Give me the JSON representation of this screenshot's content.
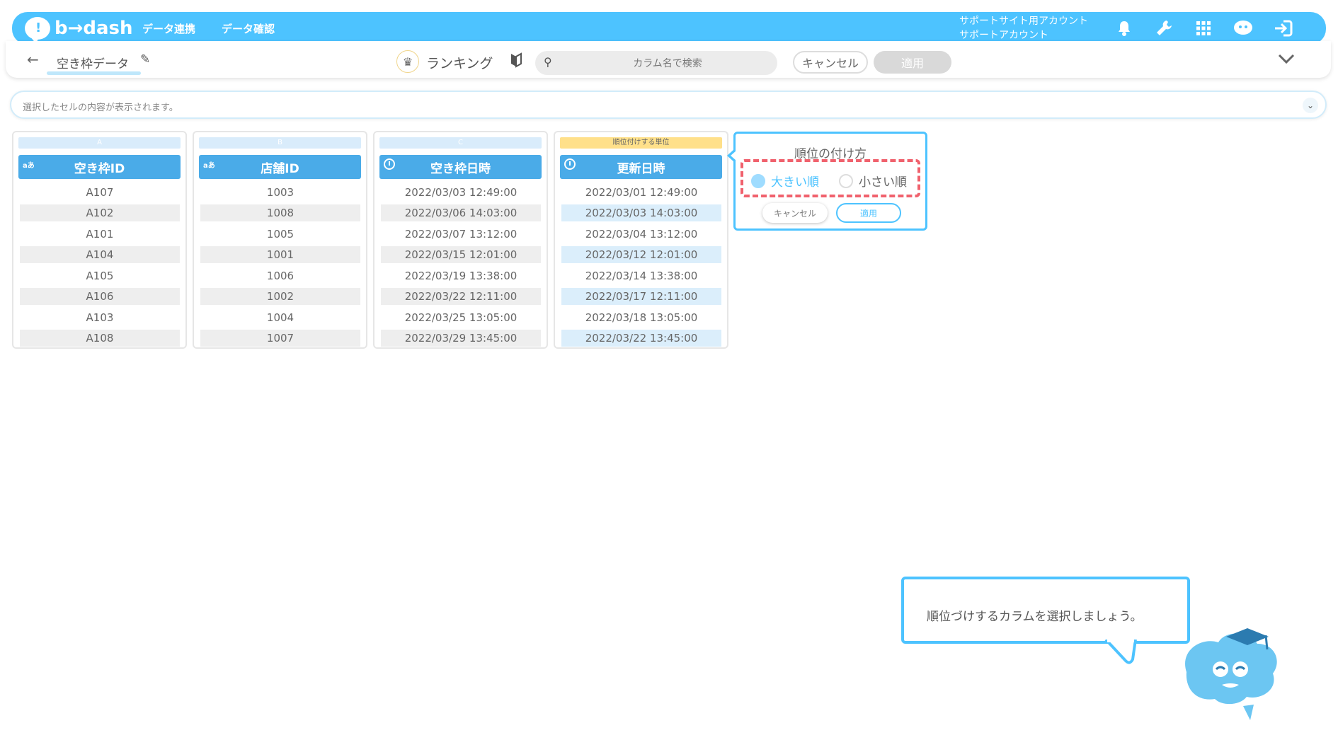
{
  "header": {
    "logo_text": "b→dash",
    "nav": [
      "データ連携",
      "データ確認"
    ],
    "account_line1": "サポートサイト用アカウント",
    "account_line2": "サポートアカウント",
    "icons": [
      "bell-icon",
      "wrench-icon",
      "grid-icon",
      "mascot-chat-icon",
      "logout-icon"
    ],
    "color": "#4dc3ff"
  },
  "toolbar": {
    "back_icon": "←",
    "table_name": "空き枠データ",
    "rank_label": "ランキング",
    "search_placeholder": "カラム名で検索",
    "cancel_label": "キャンセル",
    "apply_label": "適用"
  },
  "formula_bar": {
    "placeholder": "選択したセルの内容が表示されます。"
  },
  "columns": [
    {
      "letter": "A",
      "type_icon": "text-type-icon",
      "name": "空き枠ID",
      "cells": [
        "A107",
        "A102",
        "A101",
        "A104",
        "A105",
        "A106",
        "A103",
        "A108"
      ]
    },
    {
      "letter": "B",
      "type_icon": "text-type-icon",
      "name": "店舗ID",
      "cells": [
        "1003",
        "1008",
        "1005",
        "1001",
        "1006",
        "1002",
        "1004",
        "1007"
      ]
    },
    {
      "letter": "C",
      "type_icon": "datetime-type-icon",
      "name": "空き枠日時",
      "cells": [
        "2022/03/03 12:49:00",
        "2022/03/06 14:03:00",
        "2022/03/07 13:12:00",
        "2022/03/15 12:01:00",
        "2022/03/19 13:38:00",
        "2022/03/22 12:11:00",
        "2022/03/25 13:05:00",
        "2022/03/29 13:45:00"
      ]
    },
    {
      "letter": "順位付けする単位",
      "type_icon": "datetime-type-icon",
      "name": "更新日時",
      "cells": [
        "2022/03/01 12:49:00",
        "2022/03/03 14:03:00",
        "2022/03/04 13:12:00",
        "2022/03/12 12:01:00",
        "2022/03/14 13:38:00",
        "2022/03/17 12:11:00",
        "2022/03/18 13:05:00",
        "2022/03/22 13:45:00"
      ]
    }
  ],
  "popover": {
    "title": "順位の付け方",
    "option_desc": "大きい順",
    "option_asc": "小さい順",
    "selected": "大きい順",
    "cancel_label": "キャンセル",
    "apply_label": "適用"
  },
  "guide": {
    "message": "順位づけするカラムを選択しましょう。"
  }
}
